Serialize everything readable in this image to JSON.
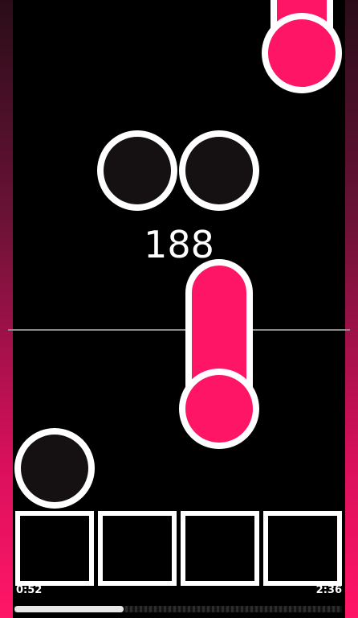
{
  "score": "188",
  "elapsed_time": "0:52",
  "total_time": "2:36",
  "progress_fraction": 0.333,
  "colors": {
    "note_pink": "#ff1566",
    "note_dark": "#151112",
    "outline": "#ffffff",
    "background": "#000000"
  },
  "lanes": [
    {
      "lane": 1
    },
    {
      "lane": 2
    },
    {
      "lane": 3
    },
    {
      "lane": 4
    }
  ]
}
